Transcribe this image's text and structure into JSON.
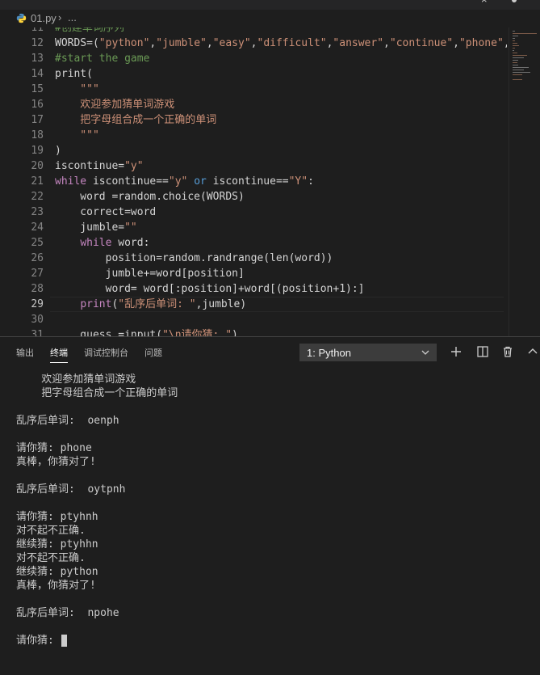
{
  "titlebar": {
    "close_glyph": "×"
  },
  "breadcrumb": {
    "file": "01.py",
    "sep": "›",
    "more": "..."
  },
  "editor": {
    "first_line_number": 11,
    "current_line_number": 29,
    "lines": [
      [
        {
          "t": "#创建单词序列",
          "c": "cm"
        }
      ],
      [
        {
          "t": "WORDS=("
        },
        {
          "t": "\"python\"",
          "c": "str"
        },
        {
          "t": ","
        },
        {
          "t": "\"jumble\"",
          "c": "str"
        },
        {
          "t": ","
        },
        {
          "t": "\"easy\"",
          "c": "str"
        },
        {
          "t": ","
        },
        {
          "t": "\"difficult\"",
          "c": "str"
        },
        {
          "t": ","
        },
        {
          "t": "\"answer\"",
          "c": "str"
        },
        {
          "t": ","
        },
        {
          "t": "\"continue\"",
          "c": "str"
        },
        {
          "t": ","
        },
        {
          "t": "\"phone\"",
          "c": "str"
        },
        {
          "t": ",\""
        }
      ],
      [
        {
          "t": "#start the game",
          "c": "cm"
        }
      ],
      [
        {
          "t": "print("
        }
      ],
      [
        {
          "t": "    \"\"\"",
          "c": "str"
        }
      ],
      [
        {
          "t": "    欢迎参加猜单词游戏",
          "c": "str"
        }
      ],
      [
        {
          "t": "    把字母组合成一个正确的单词",
          "c": "str"
        }
      ],
      [
        {
          "t": "    \"\"\"",
          "c": "str"
        }
      ],
      [
        {
          "t": ")"
        }
      ],
      [
        {
          "t": "iscontinue="
        },
        {
          "t": "\"y\"",
          "c": "str"
        }
      ],
      [
        {
          "t": "while",
          "c": "kw"
        },
        {
          "t": " iscontinue=="
        },
        {
          "t": "\"y\"",
          "c": "str"
        },
        {
          "t": " "
        },
        {
          "t": "or",
          "c": "op"
        },
        {
          "t": " iscontinue=="
        },
        {
          "t": "\"Y\"",
          "c": "str"
        },
        {
          "t": ":"
        }
      ],
      [
        {
          "t": "    word =random.choice(WORDS)"
        }
      ],
      [
        {
          "t": "    correct=word"
        }
      ],
      [
        {
          "t": "    jumble="
        },
        {
          "t": "\"\"",
          "c": "str"
        }
      ],
      [
        {
          "t": "    "
        },
        {
          "t": "while",
          "c": "kw"
        },
        {
          "t": " word:"
        }
      ],
      [
        {
          "t": "        position=random.randrange(len(word))"
        }
      ],
      [
        {
          "t": "        jumble+=word[position]"
        }
      ],
      [
        {
          "t": "        word= word[:position]+word[(position+1):]"
        }
      ],
      [
        {
          "t": "    "
        },
        {
          "t": "print",
          "c": "kw"
        },
        {
          "t": "("
        },
        {
          "t": "\"乱序后单词: \"",
          "c": "str"
        },
        {
          "t": ",jumble)"
        }
      ],
      [
        {
          "t": ""
        }
      ],
      [
        {
          "t": "    guess =input("
        },
        {
          "t": "\"\\n请你猜: \"",
          "c": "str"
        },
        {
          "t": ")"
        }
      ]
    ]
  },
  "panel": {
    "tabs": [
      {
        "label": "输出",
        "active": false
      },
      {
        "label": "终端",
        "active": true
      },
      {
        "label": "调试控制台",
        "active": false
      },
      {
        "label": "问题",
        "active": false
      }
    ],
    "terminal_select": "1: Python"
  },
  "terminal": {
    "lines": [
      "    欢迎参加猜单词游戏",
      "    把字母组合成一个正确的单词",
      "",
      "乱序后单词:  oenph",
      "",
      "请你猜: phone",
      "真棒，你猜对了!",
      "",
      "乱序后单词:  oytpnh",
      "",
      "请你猜: ptyhnh",
      "对不起不正确.",
      "继续猜: ptyhhn",
      "对不起不正确.",
      "继续猜: python",
      "真棒，你猜对了!",
      "",
      "乱序后单词:  npohe",
      "",
      "请你猜: "
    ]
  },
  "colors": {
    "string": "#ce9178",
    "keyword": "#c586c0",
    "operator": "#569cd6",
    "comment": "#6a9955",
    "background": "#1e1e1e"
  }
}
